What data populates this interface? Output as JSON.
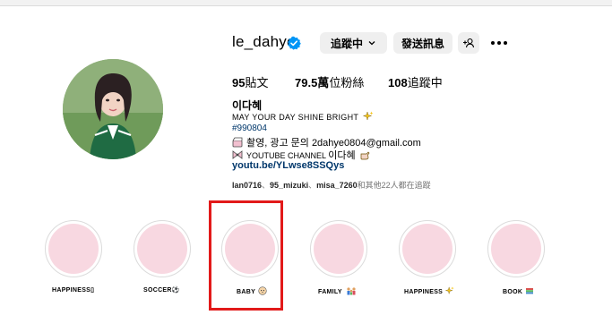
{
  "profile": {
    "username": "le_dahye",
    "buttons": {
      "follow": "追蹤中",
      "message": "發送訊息"
    },
    "stats": {
      "posts": "95",
      "posts_label": "貼文",
      "followers": "79.5萬",
      "followers_label": "位粉絲",
      "following": "108",
      "following_label": "追蹤中"
    },
    "display_name": "이다혜",
    "bio": {
      "line1": "MAY YOUR DAY SHINE BRIGHT",
      "line2": "#990804",
      "line3": "촬영, 광고 문의 2dahye0804@gmail.com",
      "line4_small": "YOUTUBE CHANNEL",
      "line4_name": "이다혜",
      "link": "youtu.be/YLwse8SSQys"
    },
    "followed_by": {
      "user1": "lan0716",
      "user2": "95_mizuki",
      "user3": "misa_7260",
      "rest": "和其他22人都在追蹤"
    }
  },
  "highlights": [
    {
      "label": "HAPPINESS",
      "suffix": "▯"
    },
    {
      "label": "SOCCER",
      "suffix": "⚽"
    },
    {
      "label": "BABY",
      "suffix": ""
    },
    {
      "label": "FAMILY",
      "suffix": ""
    },
    {
      "label": "HAPPINESS",
      "suffix": ""
    },
    {
      "label": "BOOK",
      "suffix": ""
    }
  ],
  "colors": {
    "accent_link": "#00376b",
    "verified": "#0095f6",
    "highlight_fill": "#f8d8e1",
    "annotation_box": "#e21a1a"
  }
}
